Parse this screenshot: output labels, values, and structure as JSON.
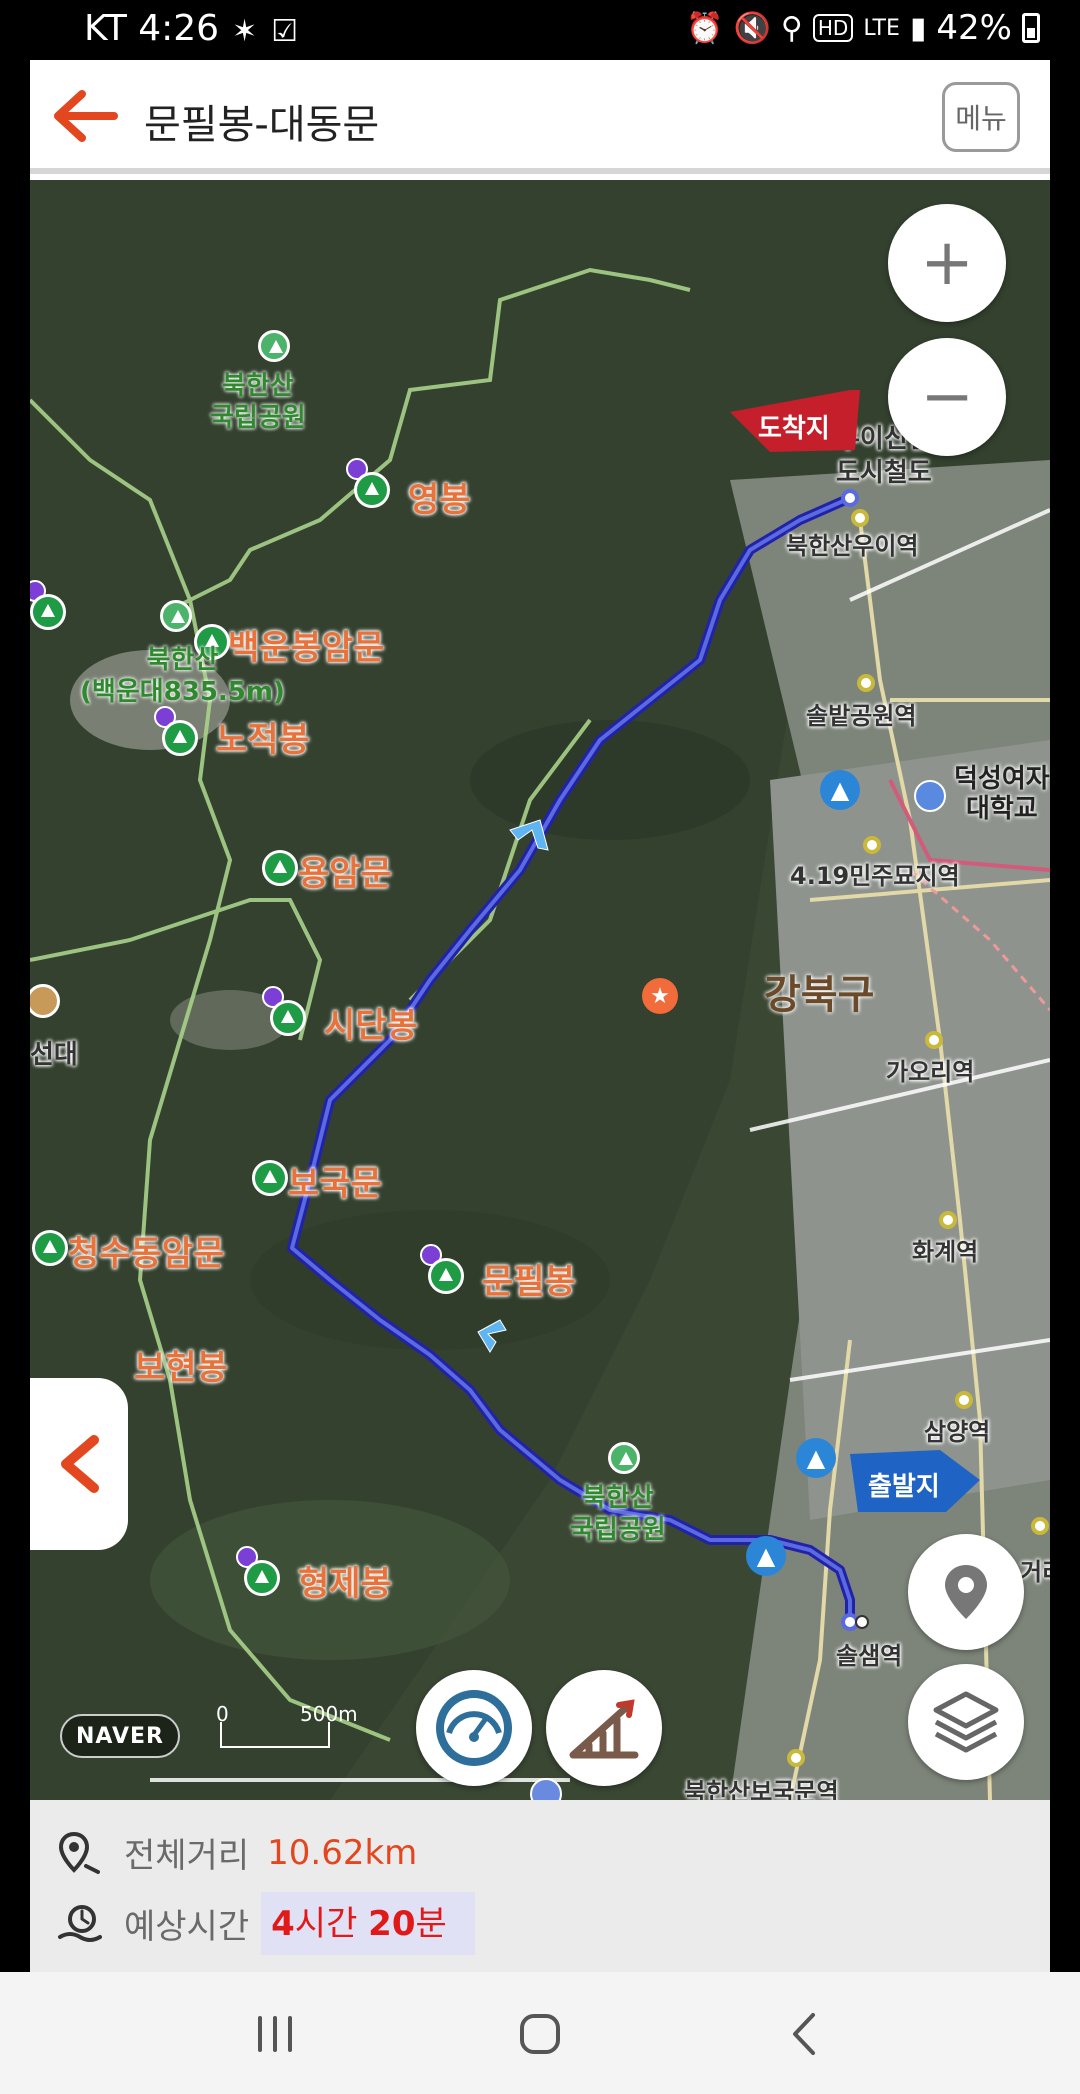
{
  "status_bar": {
    "carrier_time": "KT 4:26",
    "network": "LTE",
    "battery": "42%"
  },
  "header": {
    "title": "문필봉-대동문",
    "menu_label": "메뉴"
  },
  "map": {
    "peaks": [
      "영봉",
      "백운봉암문",
      "노적봉",
      "용암문",
      "시단봉",
      "보국문",
      "청수동암문",
      "문필봉",
      "보현봉",
      "형제봉"
    ],
    "park_labels": [
      "북한산\n국립공원",
      "북한산\n국립공원"
    ],
    "summit_label": "북한산\n(백운대835.5m)",
    "stations": [
      "북한산우이역",
      "솔밭공원역",
      "4.19민주묘지역",
      "가오리역",
      "화계역",
      "삼양역",
      "솔샘역",
      "북한산보국문역"
    ],
    "light_rail": "우이신설\n도시철도",
    "district": "강북구",
    "university": "덕성여자\n대학교",
    "left_edge_label": "선대",
    "right_edge_partial": "거리",
    "flag_end": "도착지",
    "flag_start": "출발지",
    "zoom_in": "+",
    "zoom_out": "−",
    "naver_logo": "NAVER",
    "scale_zero": "0",
    "scale_distance": "500m",
    "route_color": "#3a3ab8"
  },
  "summary": {
    "distance_label": "전체거리",
    "distance_value": "10.62km",
    "time_label": "예상시간",
    "time_hours_num": "4",
    "time_hours_unit": "시간",
    "time_minutes_num": "20",
    "time_minutes_unit": "분"
  },
  "colors": {
    "accent": "#e2471f",
    "time_red": "#e01919",
    "peak_orange": "#e8723a",
    "park_green": "#2f8a2f"
  }
}
